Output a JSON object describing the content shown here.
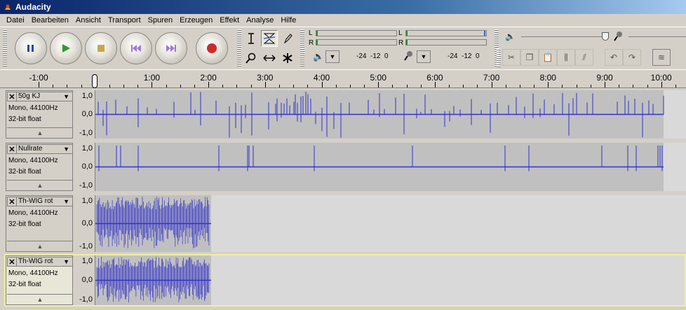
{
  "window": {
    "title": "Audacity"
  },
  "menu": [
    "Datei",
    "Bearbeiten",
    "Ansicht",
    "Transport",
    "Spuren",
    "Erzeugen",
    "Effekt",
    "Analyse",
    "Hilfe"
  ],
  "transport": [
    "pause",
    "play",
    "stop",
    "skip-start",
    "skip-end",
    "record"
  ],
  "meters": {
    "left_label": "L",
    "right_label": "R",
    "play_scale": "-24  -12  0",
    "rec_scale": "-24  -12  0"
  },
  "ruler": {
    "labels": [
      "-1:00",
      "0",
      "1:00",
      "2:00",
      "3:00",
      "4:00",
      "5:00",
      "6:00",
      "7:00",
      "8:00",
      "9:00",
      "10:00"
    ]
  },
  "tracks": [
    {
      "name": "50g KJ",
      "format": "Mono, 44100Hz",
      "bits": "32-bit float",
      "scale_top": "1,0",
      "scale_mid": "0,0",
      "scale_bot": "-1,0",
      "selected": false,
      "clip_end_frac": 1.0
    },
    {
      "name": "Nullrate",
      "format": "Mono, 44100Hz",
      "bits": "32-bit float",
      "scale_top": "1,0",
      "scale_mid": "0,0",
      "scale_bot": "-1,0",
      "selected": false,
      "clip_end_frac": 1.0
    },
    {
      "name": "Th-WIG rot",
      "format": "Mono, 44100Hz",
      "bits": "32-bit float",
      "scale_top": "1,0",
      "scale_mid": "0,0",
      "scale_bot": "-1,0",
      "selected": false,
      "clip_end_frac": 0.2
    },
    {
      "name": "Th-WIG rot",
      "format": "Mono, 44100Hz",
      "bits": "32-bit float",
      "scale_top": "1,0",
      "scale_mid": "0,0",
      "scale_bot": "-1,0",
      "selected": true,
      "clip_end_frac": 0.2
    }
  ],
  "colors": {
    "wave": "#3232c8",
    "wave_bg_clip": "#c0c0c0",
    "wave_bg_empty": "#d9d9d9",
    "selected_panel": "#e8e6d6"
  }
}
